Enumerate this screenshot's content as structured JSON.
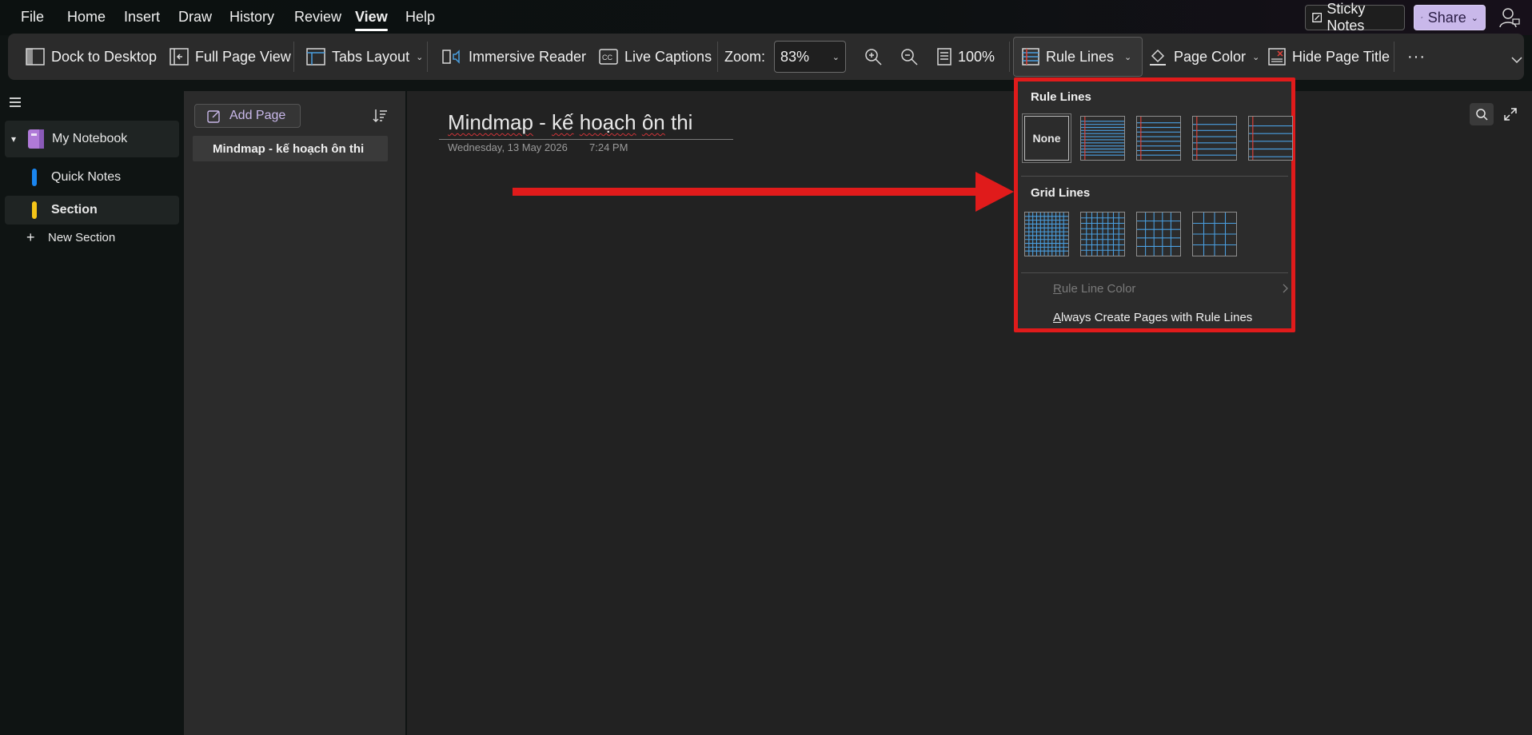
{
  "menu": {
    "items": [
      "File",
      "Home",
      "Insert",
      "Draw",
      "History",
      "Review",
      "View",
      "Help"
    ],
    "active": "View"
  },
  "top_right": {
    "sticky_notes": "Sticky Notes",
    "share": "Share"
  },
  "ribbon": {
    "dock": "Dock to Desktop",
    "full_page": "Full Page View",
    "tabs_layout": "Tabs Layout",
    "immersive_reader": "Immersive Reader",
    "live_captions": "Live Captions",
    "zoom_label": "Zoom:",
    "zoom_value": "83%",
    "zoom_100": "100%",
    "rule_lines": "Rule Lines",
    "page_color": "Page Color",
    "hide_page_title": "Hide Page Title",
    "more": "···"
  },
  "nav": {
    "notebook": "My Notebook",
    "sections": [
      {
        "label": "Quick Notes",
        "color": "#1a86f0"
      },
      {
        "label": "Section",
        "color": "#f5c518"
      }
    ],
    "new_section": "New Section"
  },
  "pages": {
    "add_page": "Add Page",
    "list": [
      "Mindmap - kế hoạch ôn thi"
    ]
  },
  "page": {
    "title_parts": [
      "Mindmap",
      " - ",
      "kế",
      " ",
      "hoạch",
      " ",
      "ôn",
      " ",
      "thi"
    ],
    "date": "Wednesday, 13 May 2026",
    "time": "7:24 PM"
  },
  "dropdown": {
    "rule_header": "Rule Lines",
    "none_label": "None",
    "grid_header": "Grid Lines",
    "rule_color_prefix": "R",
    "rule_color_rest": "ule Line Color",
    "always_prefix": "A",
    "always_rest": "lways Create Pages with Rule Lines"
  },
  "colors": {
    "accent_purple": "#c9b8ea",
    "highlight_red": "#e01b1b",
    "rule_blue": "#4a9fe0",
    "margin_red": "#e0413a"
  }
}
